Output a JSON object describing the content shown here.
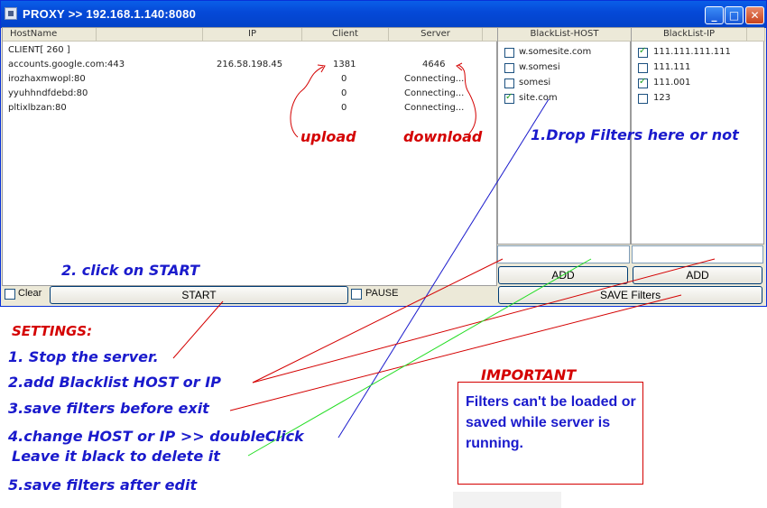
{
  "window": {
    "title": "PROXY  >> 192.168.1.140:8080",
    "min_glyph": "_",
    "max_glyph": "□",
    "close_glyph": "✕"
  },
  "connections": {
    "columns": [
      "HostName",
      "IP",
      "Client",
      "Server"
    ],
    "rows": [
      {
        "host": "CLIENT[ 260 ]",
        "ip": "",
        "client": "",
        "server": ""
      },
      {
        "host": "accounts.google.com:443",
        "ip": "216.58.198.45",
        "client": "1381",
        "server": "4646"
      },
      {
        "host": "irozhaxmwopl:80",
        "ip": "",
        "client": "0",
        "server": "Connecting..."
      },
      {
        "host": "yyuhhndfdebd:80",
        "ip": "",
        "client": "0",
        "server": "Connecting..."
      },
      {
        "host": "pltixlbzan:80",
        "ip": "",
        "client": "0",
        "server": "Connecting..."
      }
    ]
  },
  "blacklist_host": {
    "header": "BlackList-HOST",
    "items": [
      {
        "label": "w.somesite.com",
        "checked": false
      },
      {
        "label": "w.somesi",
        "checked": false
      },
      {
        "label": "somesi",
        "checked": false
      },
      {
        "label": "site.com",
        "checked": true
      }
    ],
    "input_value": "",
    "add_label": "ADD"
  },
  "blacklist_ip": {
    "header": "BlackList-IP",
    "items": [
      {
        "label": "111.111.111.111",
        "checked": true
      },
      {
        "label": "111.111",
        "checked": false
      },
      {
        "label": "111.001",
        "checked": true
      },
      {
        "label": "123",
        "checked": false
      }
    ],
    "input_value": "",
    "add_label": "ADD"
  },
  "controls": {
    "clear_label": "Clear",
    "clear_checked": false,
    "start_label": "START",
    "pause_label": "PAUSE",
    "pause_checked": false,
    "save_filters_label": "SAVE Filters"
  },
  "annotations": {
    "upload": "upload",
    "download": "download",
    "drop_filters": "1.Drop Filters here or not",
    "click_start": "2. click on START",
    "settings": "SETTINGS:",
    "step1": "1. Stop the server.",
    "step2": "2.add Blacklist HOST or IP",
    "step3": "3.save filters before exit",
    "step4": "4.change HOST or IP >> doubleClick",
    "step4b": "Leave it black to delete it",
    "step5": "5.save filters after edit",
    "important": "IMPORTANT",
    "note": "Filters can't be loaded or saved while server is running."
  },
  "colors": {
    "annotation_red": "#d40000",
    "annotation_blue": "#1a1acc",
    "line_green": "#22dd22",
    "titlebar_blue": "#0549d8"
  }
}
